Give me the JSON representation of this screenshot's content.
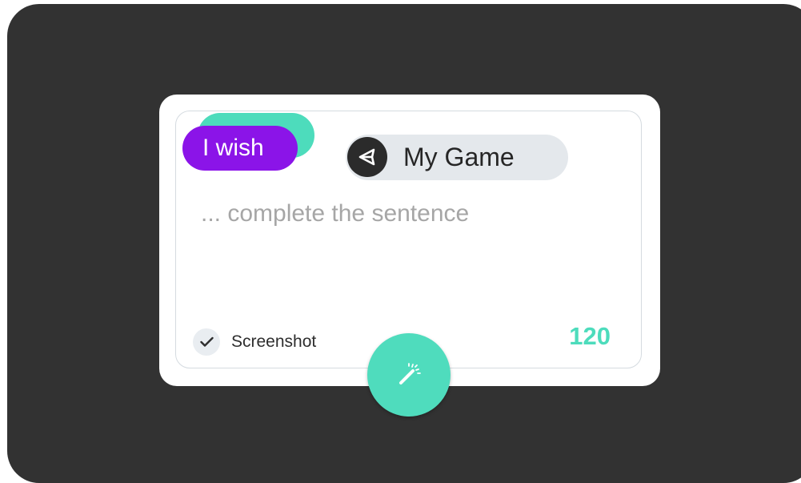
{
  "card": {
    "tag_label": "I wish",
    "game_label": "My Game",
    "game_icon": "unity-icon",
    "prompt_placeholder": "... complete the sentence",
    "screenshot_label": "Screenshot",
    "screenshot_checked": true,
    "char_count": "120"
  },
  "fab": {
    "icon": "magic-wand-icon"
  },
  "colors": {
    "frame": "#323232",
    "tag_purple": "#8b14e8",
    "accent_teal": "#4ddcbc",
    "pill_gray": "#e4e8ec",
    "placeholder_gray": "#a6a6a6"
  }
}
